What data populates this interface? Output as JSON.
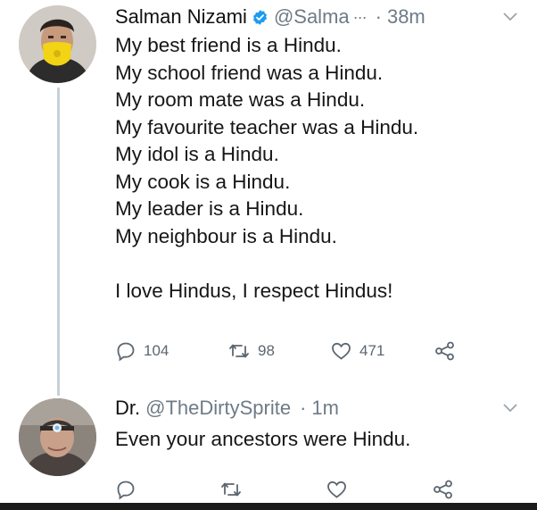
{
  "tweet1": {
    "author_name": "Salman Nizami",
    "handle": "@Salma",
    "handle_ellipsis": "···",
    "time": "38m",
    "lines": [
      "My best friend is a Hindu.",
      "My school friend was a Hindu.",
      "My room mate was a Hindu.",
      "My favourite teacher was a Hindu.",
      "My idol is a Hindu.",
      "My cook is a Hindu.",
      "My leader is a Hindu.",
      "My neighbour is a Hindu.",
      "",
      "I love Hindus, I respect Hindus!"
    ],
    "reply_count": "104",
    "retweet_count": "98",
    "like_count": "471"
  },
  "tweet2": {
    "author_name": "Dr.",
    "handle": "@TheDirtySprite",
    "time": "1m",
    "text": "Even your ancestors were Hindu."
  },
  "icons": {
    "verified": "verified-badge-icon",
    "reply": "reply-bubble-icon",
    "retweet": "retweet-icon",
    "like": "heart-icon",
    "share": "share-icon",
    "more": "chevron-down-icon"
  },
  "colors": {
    "verified": "#1d9bf0",
    "muted": "#6e7b86",
    "thread_line": "#c6d0d7"
  }
}
